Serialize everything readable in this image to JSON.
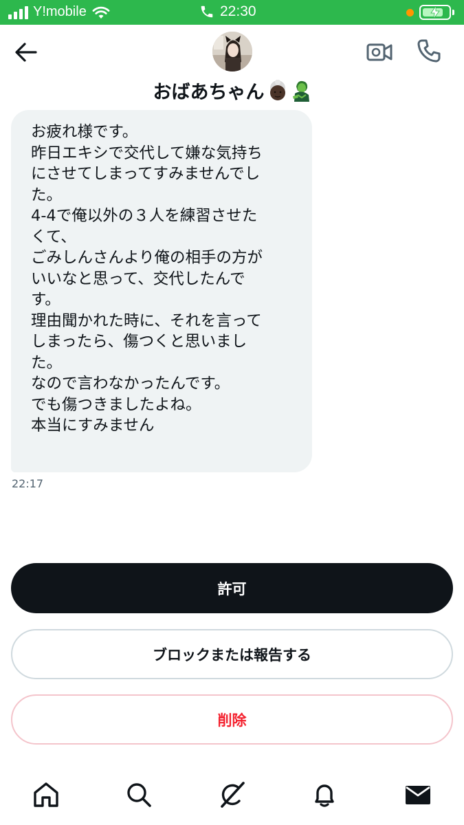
{
  "status_bar": {
    "carrier": "Y!mobile",
    "time": "22:30"
  },
  "header": {
    "contact_name": "おばあちゃん"
  },
  "message": {
    "lines": [
      "お疲れ様です。",
      "昨日エキシで交代して嫌な気持ち",
      "にさせてしまってすみませんでし",
      "た。",
      "4-4で俺以外の３人を練習させた",
      "くて、",
      "ごみしんさんより俺の相手の方が",
      "いいなと思って、交代したんで",
      "す。",
      "理由聞かれた時に、それを言って",
      "しまったら、傷つくと思いまし",
      "た。",
      "なので言わなかったんです。",
      "でも傷つきましたよね。",
      "本当にすみません"
    ],
    "timestamp": "22:17"
  },
  "actions": {
    "allow_label": "許可",
    "block_label": "ブロックまたは報告する",
    "delete_label": "削除"
  },
  "icons": {
    "back": "arrow-left-icon",
    "video": "video-camera-icon",
    "call": "phone-icon",
    "nav": [
      "home-icon",
      "search-icon",
      "grok-icon",
      "bell-icon",
      "mail-icon"
    ]
  },
  "colors": {
    "status_bar": "#2db84d",
    "bubble": "#eff3f4",
    "primary_button": "#0f1419",
    "delete_text": "#f4212e",
    "delete_border": "#f4c4cb",
    "secondary_text": "#536471"
  }
}
